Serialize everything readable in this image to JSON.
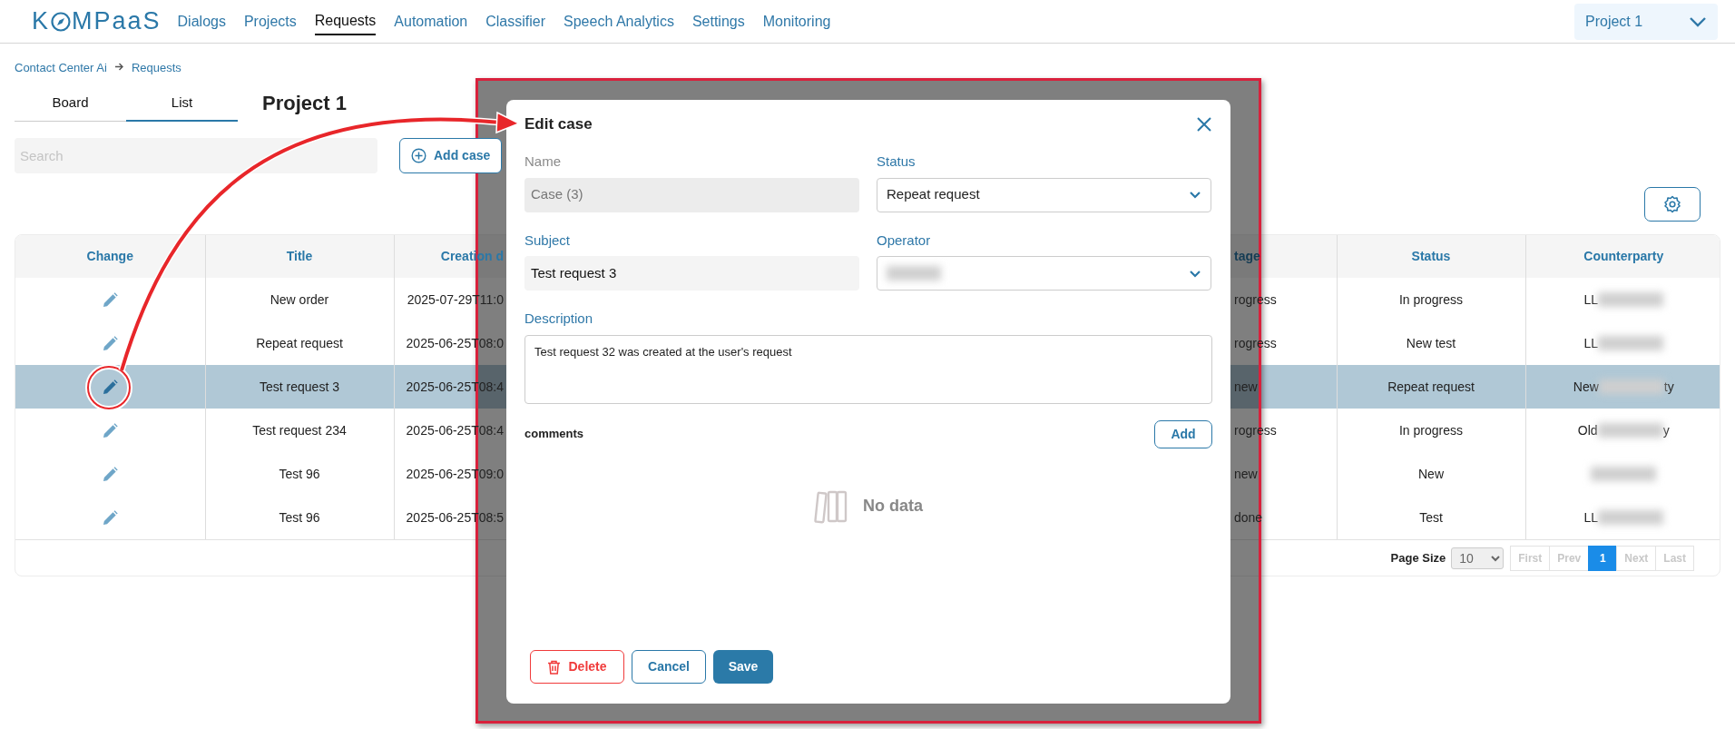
{
  "logo": {
    "before": "K",
    "after": "MPaaS"
  },
  "nav": [
    {
      "label": "Dialogs",
      "selected": false
    },
    {
      "label": "Projects",
      "selected": false
    },
    {
      "label": "Requests",
      "selected": true
    },
    {
      "label": "Automation",
      "selected": false
    },
    {
      "label": "Classifier",
      "selected": false
    },
    {
      "label": "Speech Analytics",
      "selected": false
    },
    {
      "label": "Settings",
      "selected": false
    },
    {
      "label": "Monitoring",
      "selected": false
    }
  ],
  "project_select": {
    "value": "Project 1"
  },
  "breadcrumb": [
    "Contact Center Ai",
    "Requests"
  ],
  "view_tabs": [
    {
      "label": "Board",
      "selected": false
    },
    {
      "label": "List",
      "selected": true
    }
  ],
  "page_title": "Project 1",
  "search": {
    "placeholder": "Search"
  },
  "add_case_button": "Add case",
  "table": {
    "columns": [
      "Change",
      "Title",
      "Creation d",
      "tage",
      "Status",
      "Counterparty"
    ],
    "rows": [
      {
        "selected": false,
        "title": "New order",
        "creation_date": "2025-07-29T11:0",
        "stage": "rogress",
        "status": "In progress",
        "counterparty": {
          "start": "LL"
        }
      },
      {
        "selected": false,
        "title": "Repeat request",
        "creation_date": "2025-06-25T08:0",
        "stage": "rogress",
        "status": "New test",
        "counterparty": {
          "start": "LL"
        }
      },
      {
        "selected": true,
        "title": "Test request 3",
        "creation_date": "2025-06-25T08:4",
        "stage": "new",
        "status": "Repeat request",
        "counterparty": {
          "start": "New",
          "end": "ty"
        }
      },
      {
        "selected": false,
        "title": "Test request 234",
        "creation_date": "2025-06-25T08:4",
        "stage": "rogress",
        "status": "In progress",
        "counterparty": {
          "start": "Old",
          "end": "y"
        }
      },
      {
        "selected": false,
        "title": "Test 96",
        "creation_date": "2025-06-25T09:0",
        "stage": "new",
        "status": "New",
        "counterparty": {}
      },
      {
        "selected": false,
        "title": "Test 96",
        "creation_date": "2025-06-25T08:5",
        "stage": "done",
        "status": "Test",
        "counterparty": {
          "start": "LL"
        }
      }
    ]
  },
  "pagination": {
    "page_size_label": "Page Size",
    "page_size": "10",
    "pages": [
      {
        "label": "First",
        "selected": false,
        "disabled": true
      },
      {
        "label": "Prev",
        "selected": false,
        "disabled": true
      },
      {
        "label": "1",
        "selected": true,
        "disabled": false
      },
      {
        "label": "Next",
        "selected": false,
        "disabled": true
      },
      {
        "label": "Last",
        "selected": false,
        "disabled": true
      }
    ]
  },
  "modal": {
    "title": "Edit case",
    "fields": [
      {
        "label": "Name",
        "value": "Case (3)",
        "kind": "text",
        "disabled": true
      },
      {
        "label": "Status",
        "value": "Repeat request",
        "kind": "select",
        "disabled": false
      },
      {
        "label": "Subject",
        "value": "Test request 3",
        "kind": "text",
        "disabled": false
      },
      {
        "label": "Operator",
        "kind": "select",
        "disabled": false,
        "redacted": true
      }
    ],
    "description": {
      "label": "Description",
      "value": "Test request 32 was created at the user's request"
    },
    "comments": {
      "label": "comments",
      "add_button": "Add",
      "empty_text": "No data"
    },
    "buttons": [
      {
        "label": "Delete",
        "kind": "danger"
      },
      {
        "label": "Cancel",
        "kind": "outline"
      },
      {
        "label": "Save",
        "kind": "primary"
      }
    ]
  }
}
